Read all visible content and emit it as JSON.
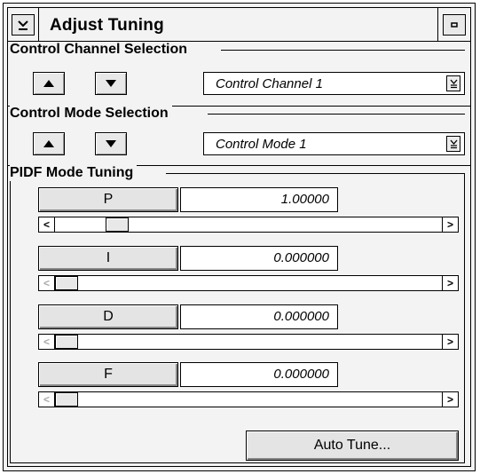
{
  "window": {
    "title": "Adjust Tuning"
  },
  "icons": {
    "menu": "chevron-down-icon",
    "minimize": "minimize-icon",
    "up": "up-arrow-icon",
    "down": "down-arrow-icon",
    "scroll_left": "scroll-left-icon",
    "scroll_right": "scroll-right-icon"
  },
  "channel_group": {
    "title": "Control Channel Selection",
    "selected": "Control Channel 1"
  },
  "mode_group": {
    "title": "Control Mode Selection",
    "selected": "Control Mode 1"
  },
  "tuning_group": {
    "title": "PIDF Mode Tuning",
    "params": [
      {
        "label": "P",
        "value": "1.00000",
        "slider_fraction": 0.14
      },
      {
        "label": "I",
        "value": "0.000000",
        "slider_fraction": 0.0
      },
      {
        "label": "D",
        "value": "0.000000",
        "slider_fraction": 0.0
      },
      {
        "label": "F",
        "value": "0.000000",
        "slider_fraction": 0.0
      }
    ],
    "auto_tune_label": "Auto Tune..."
  }
}
